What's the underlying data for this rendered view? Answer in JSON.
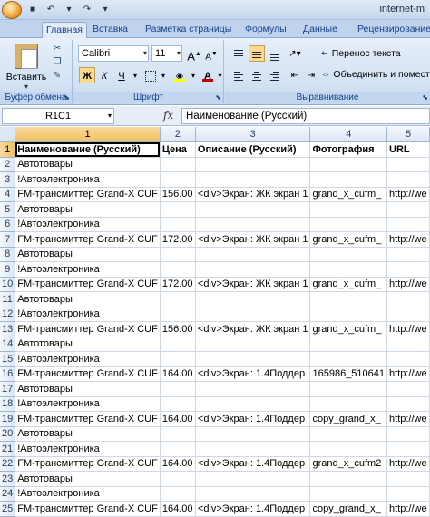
{
  "window": {
    "title": "internet-m"
  },
  "tabs": [
    "Главная",
    "Вставка",
    "Разметка страницы",
    "Формулы",
    "Данные",
    "Рецензирование"
  ],
  "ribbon": {
    "clipboard": {
      "paste_label": "Вставить",
      "group_label": "Буфер обмена"
    },
    "font": {
      "font_name": "Calibri",
      "font_size": "11",
      "bold": "Ж",
      "italic": "К",
      "underline": "Ч",
      "group_label": "Шрифт",
      "fill_color": "#ffff00",
      "font_color": "#c00000"
    },
    "alignment": {
      "wrap_text": "Перенос текста",
      "merge_center": "Объединить и помест",
      "group_label": "Выравнивание"
    }
  },
  "formula_bar": {
    "name_box": "R1C1",
    "fx": "fx",
    "content": "Наименование (Русский)"
  },
  "grid": {
    "columns": [
      "1",
      "2",
      "3",
      "4",
      "5"
    ],
    "rows": [
      {
        "num": "1",
        "cells": [
          "Наименование (Русский)",
          "Цена",
          "Описание (Русский)",
          "Фотография",
          "URL"
        ]
      },
      {
        "num": "2",
        "cells": [
          "Автотовары",
          "",
          "",
          "",
          ""
        ]
      },
      {
        "num": "3",
        "cells": [
          "!Автоэлектроника",
          "",
          "",
          "",
          ""
        ]
      },
      {
        "num": "4",
        "cells": [
          "FM-трансмиттер Grand-X CUF",
          "156.00",
          "<div>Экран: ЖК экран 1",
          "grand_x_cufm_",
          "http://we"
        ]
      },
      {
        "num": "5",
        "cells": [
          "Автотовары",
          "",
          "",
          "",
          ""
        ]
      },
      {
        "num": "6",
        "cells": [
          "!Автоэлектроника",
          "",
          "",
          "",
          ""
        ]
      },
      {
        "num": "7",
        "cells": [
          "FM-трансмиттер Grand-X CUF",
          "172.00",
          "<div>Экран: ЖК экран 1",
          "grand_x_cufm_",
          "http://we"
        ]
      },
      {
        "num": "8",
        "cells": [
          "Автотовары",
          "",
          "",
          "",
          ""
        ]
      },
      {
        "num": "9",
        "cells": [
          "!Автоэлектроника",
          "",
          "",
          "",
          ""
        ]
      },
      {
        "num": "10",
        "cells": [
          "FM-трансмиттер Grand-X CUF",
          "172.00",
          "<div>Экран: ЖК экран 1",
          "grand_x_cufm_",
          "http://we"
        ]
      },
      {
        "num": "11",
        "cells": [
          "Автотовары",
          "",
          "",
          "",
          ""
        ]
      },
      {
        "num": "12",
        "cells": [
          "!Автоэлектроника",
          "",
          "",
          "",
          ""
        ]
      },
      {
        "num": "13",
        "cells": [
          "FM-трансмиттер Grand-X CUF",
          "156.00",
          "<div>Экран: ЖК экран 1",
          "grand_x_cufm_",
          "http://we"
        ]
      },
      {
        "num": "14",
        "cells": [
          "Автотовары",
          "",
          "",
          "",
          ""
        ]
      },
      {
        "num": "15",
        "cells": [
          "!Автоэлектроника",
          "",
          "",
          "",
          ""
        ]
      },
      {
        "num": "16",
        "cells": [
          "FM-трансмиттер Grand-X CUF",
          "164.00",
          "<div>Экран: 1.4Поддер",
          "165986_510641",
          "http://we"
        ]
      },
      {
        "num": "17",
        "cells": [
          "Автотовары",
          "",
          "",
          "",
          ""
        ]
      },
      {
        "num": "18",
        "cells": [
          "!Автоэлектроника",
          "",
          "",
          "",
          ""
        ]
      },
      {
        "num": "19",
        "cells": [
          "FM-трансмиттер Grand-X CUF",
          "164.00",
          "<div>Экран: 1.4Поддер",
          "copy_grand_x_",
          "http://we"
        ]
      },
      {
        "num": "20",
        "cells": [
          "Автотовары",
          "",
          "",
          "",
          ""
        ]
      },
      {
        "num": "21",
        "cells": [
          "!Автоэлектроника",
          "",
          "",
          "",
          ""
        ]
      },
      {
        "num": "22",
        "cells": [
          "FM-трансмиттер Grand-X CUF",
          "164.00",
          "<div>Экран: 1.4Поддер",
          "grand_x_cufm2",
          "http://we"
        ]
      },
      {
        "num": "23",
        "cells": [
          "Автотовары",
          "",
          "",
          "",
          ""
        ]
      },
      {
        "num": "24",
        "cells": [
          "!Автоэлектроника",
          "",
          "",
          "",
          ""
        ]
      },
      {
        "num": "25",
        "cells": [
          "FM-трансмиттер Grand-X CUF",
          "164.00",
          "<div>Экран: 1.4Поддер",
          "copy_grand_x_",
          "http://we"
        ]
      }
    ]
  }
}
